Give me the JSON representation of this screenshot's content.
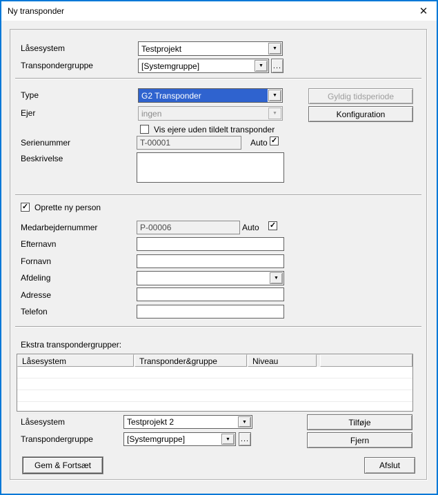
{
  "window": {
    "title": "Ny transponder"
  },
  "icons": {
    "close": "✕",
    "dropdown_arrow": "▼",
    "check": "✓",
    "ellipsis": "..."
  },
  "colors": {
    "window_border": "#0078d7",
    "selection_bg": "#2f63cf",
    "dialog_bg": "#f0f0f0"
  },
  "system_section": {
    "lock_system_label": "Låsesystem",
    "lock_system_value": "Testprojekt",
    "transponder_group_label": "Transpondergruppe",
    "transponder_group_value": "[Systemgruppe]"
  },
  "type_section": {
    "type_label": "Type",
    "type_value": "G2 Transponder",
    "owner_label": "Ejer",
    "owner_value": "ingen",
    "show_owners_label": "Vis ejere uden tildelt transponder",
    "show_owners_checked": false,
    "serial_label": "Serienummer",
    "serial_value": "T-00001",
    "serial_auto_label": "Auto",
    "serial_auto_checked": true,
    "description_label": "Beskrivelse",
    "description_value": "",
    "valid_period_button": "Gyldig tidsperiode",
    "configuration_button": "Konfiguration"
  },
  "person_section": {
    "create_person_label": "Oprette ny person",
    "create_person_checked": true,
    "employee_number_label": "Medarbejdernummer",
    "employee_number_value": "P-00006",
    "employee_auto_label": "Auto",
    "employee_auto_checked": true,
    "last_name_label": "Efternavn",
    "last_name_value": "",
    "first_name_label": "Fornavn",
    "first_name_value": "",
    "department_label": "Afdeling",
    "department_value": "",
    "address_label": "Adresse",
    "address_value": "",
    "phone_label": "Telefon",
    "phone_value": ""
  },
  "extra_groups_section": {
    "heading": "Ekstra transpondergrupper:",
    "table": {
      "columns": [
        "Låsesystem",
        "Transponder&gruppe",
        "Niveau",
        ""
      ],
      "rows": []
    },
    "lock_system_label": "Låsesystem",
    "lock_system_value": "Testprojekt 2",
    "transponder_group_label": "Transpondergruppe",
    "transponder_group_value": "[Systemgruppe]",
    "add_button": "Tilføje",
    "remove_button": "Fjern"
  },
  "footer": {
    "save_continue_button": "Gem & Fortsæt",
    "exit_button": "Afslut"
  }
}
